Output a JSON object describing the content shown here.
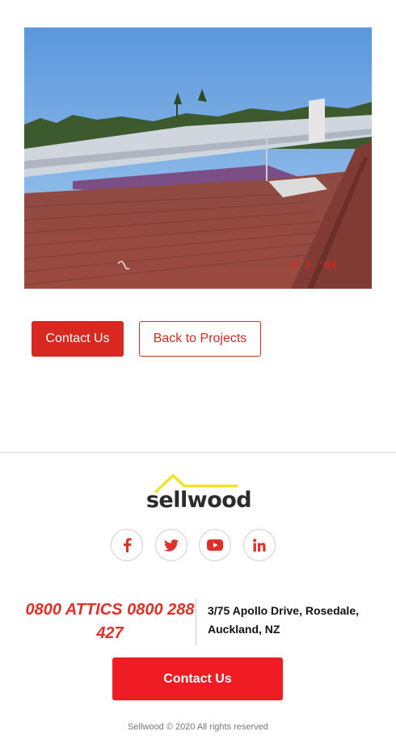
{
  "project": {
    "photo_alt": "Roof project photo",
    "photo_date": "6  3 '08"
  },
  "actions": {
    "contact_label": "Contact Us",
    "back_label": "Back to Projects"
  },
  "footer": {
    "logo_text": "sellwood",
    "social": [
      {
        "name": "facebook",
        "icon": "facebook-icon"
      },
      {
        "name": "twitter",
        "icon": "twitter-icon"
      },
      {
        "name": "youtube",
        "icon": "youtube-icon"
      },
      {
        "name": "linkedin",
        "icon": "linkedin-icon"
      }
    ],
    "phone": "0800 ATTICS 0800 288 427",
    "address": "3/75 Apollo Drive, Rosedale, Auckland, NZ",
    "contact_label": "Contact Us",
    "copyright": "Sellwood © 2020 All rights reserved"
  },
  "colors": {
    "brand_red": "#d8281f",
    "footer_red": "#ef1c24",
    "logo_yellow": "#f4e11b"
  }
}
